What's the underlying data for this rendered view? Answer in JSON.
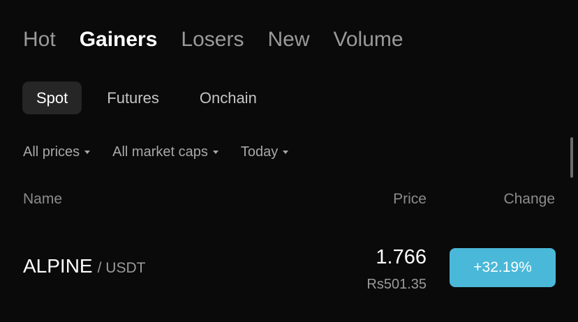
{
  "top_tabs": [
    {
      "label": "Hot",
      "active": false
    },
    {
      "label": "Gainers",
      "active": true
    },
    {
      "label": "Losers",
      "active": false
    },
    {
      "label": "New",
      "active": false
    },
    {
      "label": "Volume",
      "active": false
    }
  ],
  "sub_tabs": [
    {
      "label": "Spot",
      "active": true
    },
    {
      "label": "Futures",
      "active": false
    },
    {
      "label": "Onchain",
      "active": false
    }
  ],
  "filters": [
    {
      "label": "All prices",
      "icon": "caret-down-icon"
    },
    {
      "label": "All market caps",
      "icon": "caret-down-icon"
    },
    {
      "label": "Today",
      "icon": "caret-down-icon"
    }
  ],
  "columns": {
    "name": "Name",
    "price": "Price",
    "change": "Change"
  },
  "rows": [
    {
      "base": "ALPINE",
      "quote": "/ USDT",
      "price": "1.766",
      "local_price": "Rs501.35",
      "change": "+32.19%"
    }
  ],
  "colors": {
    "gain_badge": "#4ab8d9",
    "background": "#0a0a0a",
    "active_pill": "#262626"
  }
}
